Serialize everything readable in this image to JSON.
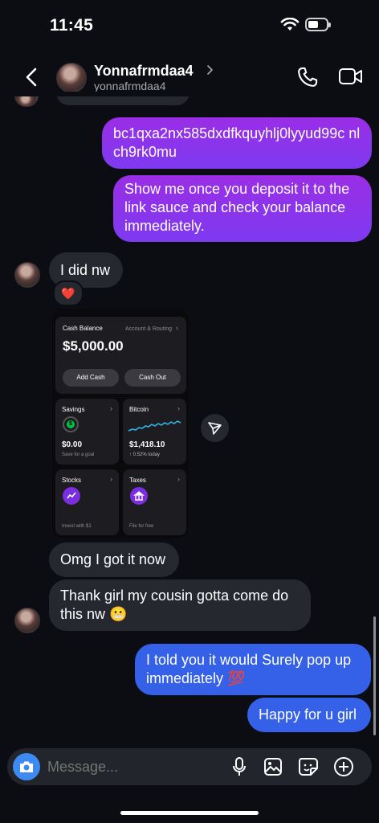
{
  "status": {
    "time": "11:45"
  },
  "header": {
    "name": "Yonnafrmdaa4",
    "handle": "yonnafrmdaa4"
  },
  "messages": {
    "wallet": "bc1qxa2nx585dxdfkquyhlj0lyyud99c nlch9rk0mu",
    "show_me": "Show me once you deposit it to the link sauce and check your balance immediately.",
    "did_nw": "I did nw",
    "reaction": "❤️",
    "got_it": "Omg I got it now",
    "thank_girl": "Thank girl my cousin gotta come do this nw 😬",
    "told_you": "I told you it would Surely pop up immediately 💯",
    "happy": "Happy for u girl"
  },
  "cash_card": {
    "balance_label": "Cash Balance",
    "routing_label": "Account & Routing",
    "balance": "$5,000.00",
    "add_cash": "Add Cash",
    "cash_out": "Cash Out",
    "savings": {
      "title": "Savings",
      "value": "$0.00",
      "sub": "Save for a goal"
    },
    "bitcoin": {
      "title": "Bitcoin",
      "value": "$1,418.10",
      "sub": "↑ 0.52% today"
    },
    "stocks": {
      "title": "Stocks",
      "sub": "Invest with $1"
    },
    "taxes": {
      "title": "Taxes",
      "sub": "File for free"
    }
  },
  "composer": {
    "placeholder": "Message..."
  },
  "colors": {
    "purple": "#8a34ec",
    "blue": "#3560e8",
    "gray_bubble": "#262830",
    "background": "#0c0d12"
  }
}
